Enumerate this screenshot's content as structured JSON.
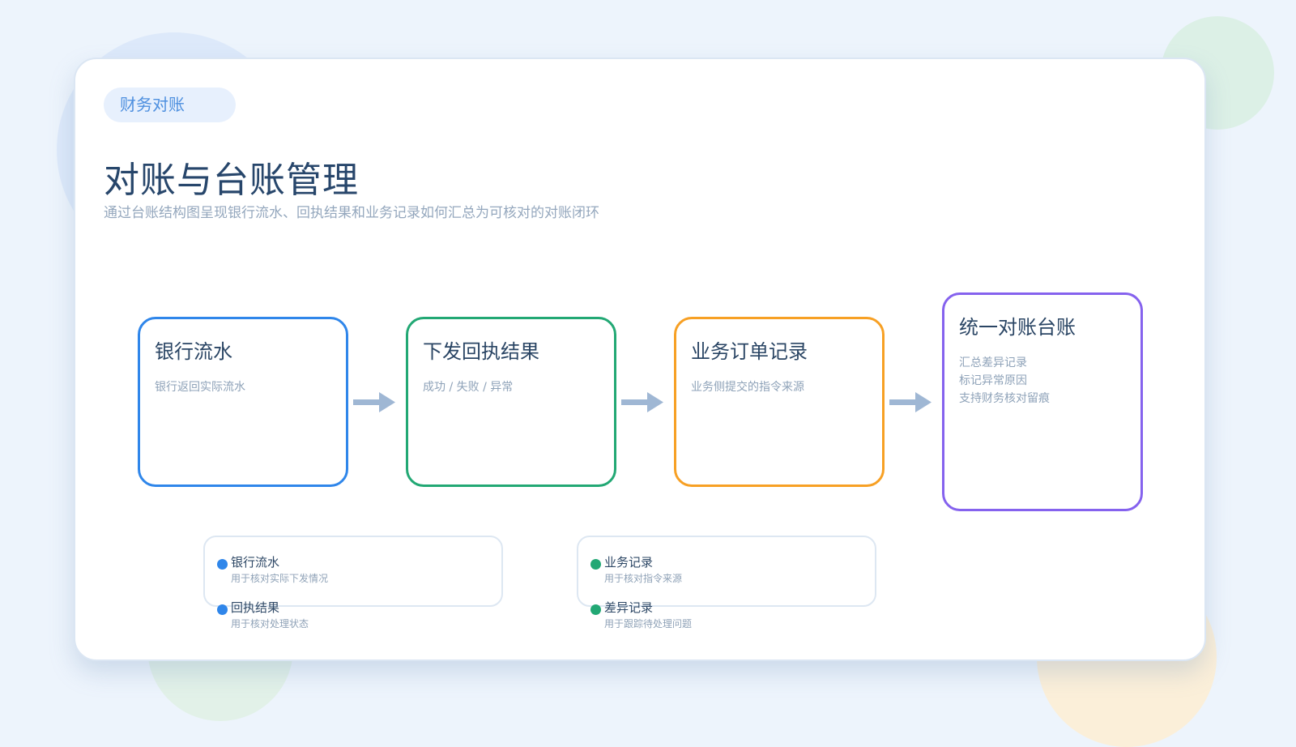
{
  "colors": {
    "background": "#edf4fc",
    "accent_blue": "#2f86ea",
    "accent_green": "#22a874",
    "accent_orange": "#f7a024",
    "accent_purple": "#8562ee",
    "arrow": "#9fb7d4",
    "title": "#27466b"
  },
  "header": {
    "tag": "财务对账",
    "title": "对账与台账管理",
    "subtitle": "通过台账结构图呈现银行流水、回执结果和业务记录如何汇总为可核对的对账闭环"
  },
  "stages": [
    {
      "title": "银行流水",
      "lines": [
        "银行返回实际流水"
      ]
    },
    {
      "title": "下发回执结果",
      "lines": [
        "成功 / 失败 / 异常"
      ]
    },
    {
      "title": "业务订单记录",
      "lines": [
        "业务侧提交的指令来源"
      ]
    },
    {
      "title": "统一对账台账",
      "lines": [
        "汇总差异记录",
        "标记异常原因",
        "支持财务核对留痕"
      ]
    }
  ],
  "arrows": [
    "arrow-right-icon",
    "arrow-right-icon",
    "arrow-right-icon"
  ],
  "legends": [
    {
      "dot_color": "#2f86ea",
      "items": [
        {
          "label": "银行流水",
          "note": "用于核对实际下发情况"
        },
        {
          "label": "回执结果",
          "note": "用于核对处理状态"
        }
      ]
    },
    {
      "dot_color": "#22a874",
      "items": [
        {
          "label": "业务记录",
          "note": "用于核对指令来源"
        },
        {
          "label": "差异记录",
          "note": "用于跟踪待处理问题"
        }
      ]
    }
  ]
}
